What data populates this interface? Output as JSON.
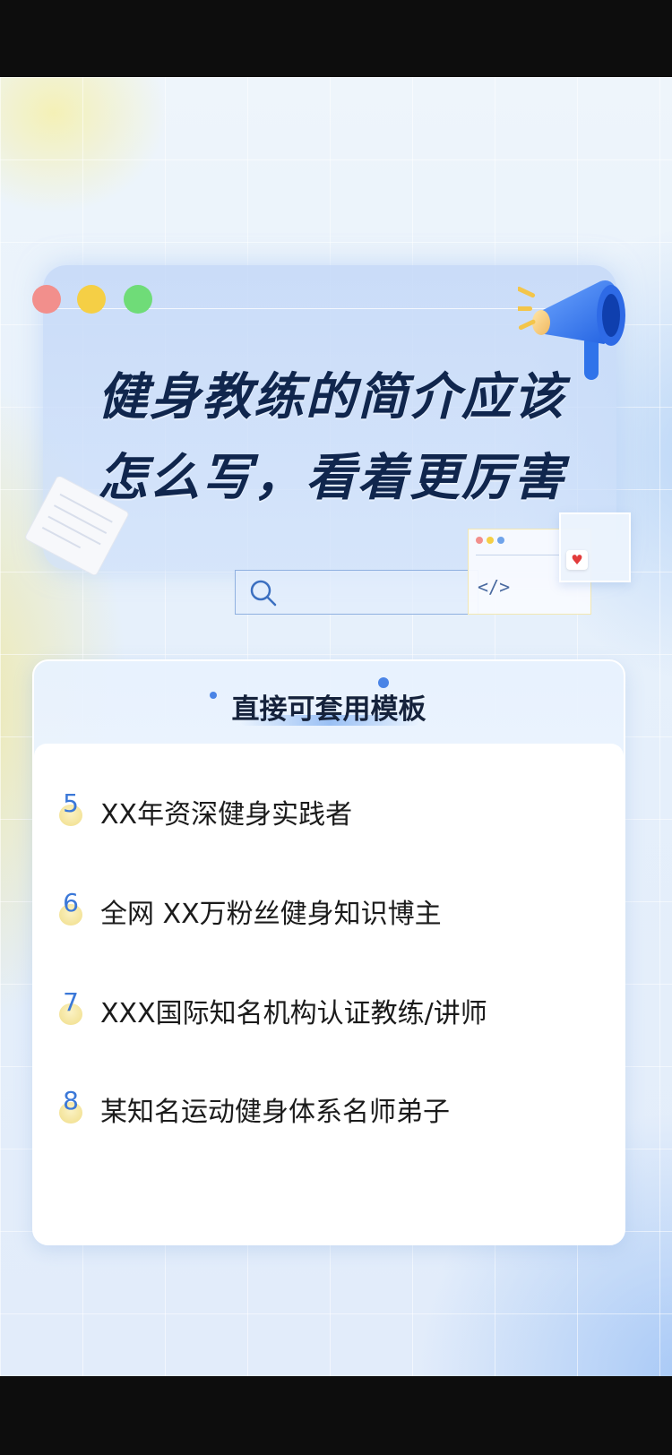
{
  "hero": {
    "title_line1": "健身教练的简介应该",
    "title_line2": "怎么写，看着更厉害",
    "code_symbol": "</>"
  },
  "template_card": {
    "heading": "直接可套用模板",
    "items": [
      {
        "number": "5",
        "text": "XX年资深健身实践者"
      },
      {
        "number": "6",
        "text": "全网 XX万粉丝健身知识博主"
      },
      {
        "number": "7",
        "text": "XXX国际知名机构认证教练/讲师"
      },
      {
        "number": "8",
        "text": "某知名运动健身体系名师弟子"
      }
    ]
  },
  "colors": {
    "title": "#10264d",
    "accent_blue": "#3b78d8",
    "number_bubble": "#f0dd88"
  },
  "icons": [
    "window-dot-red",
    "window-dot-yellow",
    "window-dot-green",
    "megaphone-icon",
    "search-icon",
    "code-icon",
    "heart-icon",
    "paper-icon"
  ]
}
